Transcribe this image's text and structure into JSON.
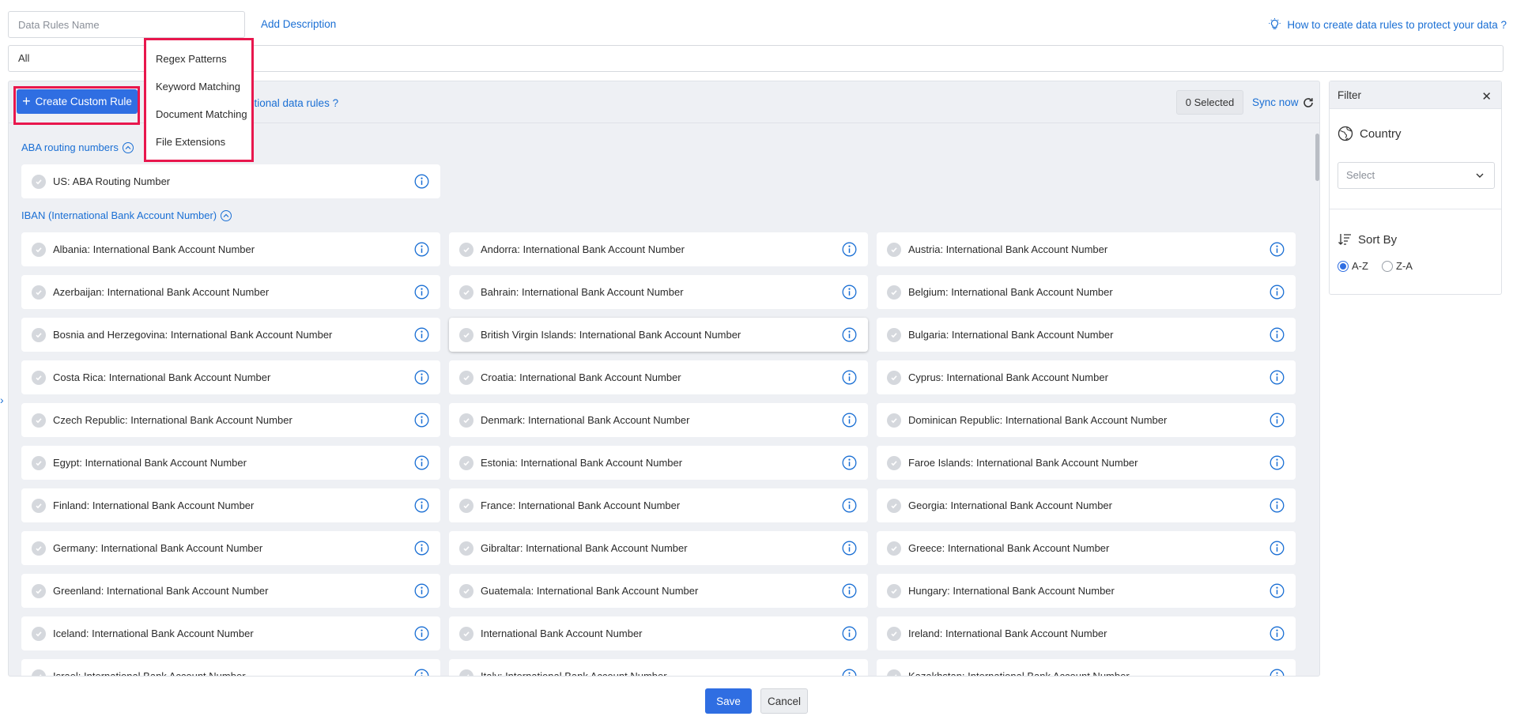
{
  "header": {
    "name_placeholder": "Data Rules Name",
    "add_description": "Add Description",
    "help_link": "How to create data rules to protect your data ?"
  },
  "scope": {
    "value": "All"
  },
  "toolbar": {
    "create_label": "Create Custom Rule",
    "additional_link": "ditional data rules ?",
    "selected_count": "0 Selected",
    "sync_label": "Sync now"
  },
  "rule_menu": {
    "items": [
      "Regex Patterns",
      "Keyword Matching",
      "Document Matching",
      "File Extensions"
    ]
  },
  "groups": [
    {
      "title": "ABA routing numbers",
      "items": [
        "US: ABA Routing Number"
      ]
    },
    {
      "title": "IBAN (International Bank Account Number)",
      "items": [
        "Albania: International Bank Account Number",
        "Andorra: International Bank Account Number",
        "Austria: International Bank Account Number",
        "Azerbaijan: International Bank Account Number",
        "Bahrain: International Bank Account Number",
        "Belgium: International Bank Account Number",
        "Bosnia and Herzegovina: International Bank Account Number",
        "British Virgin Islands: International Bank Account Number",
        "Bulgaria: International Bank Account Number",
        "Costa Rica: International Bank Account Number",
        "Croatia: International Bank Account Number",
        "Cyprus: International Bank Account Number",
        "Czech Republic: International Bank Account Number",
        "Denmark: International Bank Account Number",
        "Dominican Republic: International Bank Account Number",
        "Egypt: International Bank Account Number",
        "Estonia: International Bank Account Number",
        "Faroe Islands: International Bank Account Number",
        "Finland: International Bank Account Number",
        "France: International Bank Account Number",
        "Georgia: International Bank Account Number",
        "Germany: International Bank Account Number",
        "Gibraltar: International Bank Account Number",
        "Greece: International Bank Account Number",
        "Greenland: International Bank Account Number",
        "Guatemala: International Bank Account Number",
        "Hungary: International Bank Account Number",
        "Iceland: International Bank Account Number",
        "International Bank Account Number",
        "Ireland: International Bank Account Number",
        "Israel: International Bank Account Number",
        "Italy: International Bank Account Number",
        "Kazakhstan: International Bank Account Number"
      ]
    }
  ],
  "filter": {
    "title": "Filter",
    "country_label": "Country",
    "country_placeholder": "Select",
    "sort_label": "Sort By",
    "sort_options": [
      "A-Z",
      "Z-A"
    ],
    "sort_selected": "A-Z"
  },
  "footer": {
    "save": "Save",
    "cancel": "Cancel"
  },
  "colors": {
    "primary": "#2f6ee2",
    "link": "#1a6fd4",
    "highlight": "#e8174d",
    "panel_bg": "#eef0f4"
  }
}
